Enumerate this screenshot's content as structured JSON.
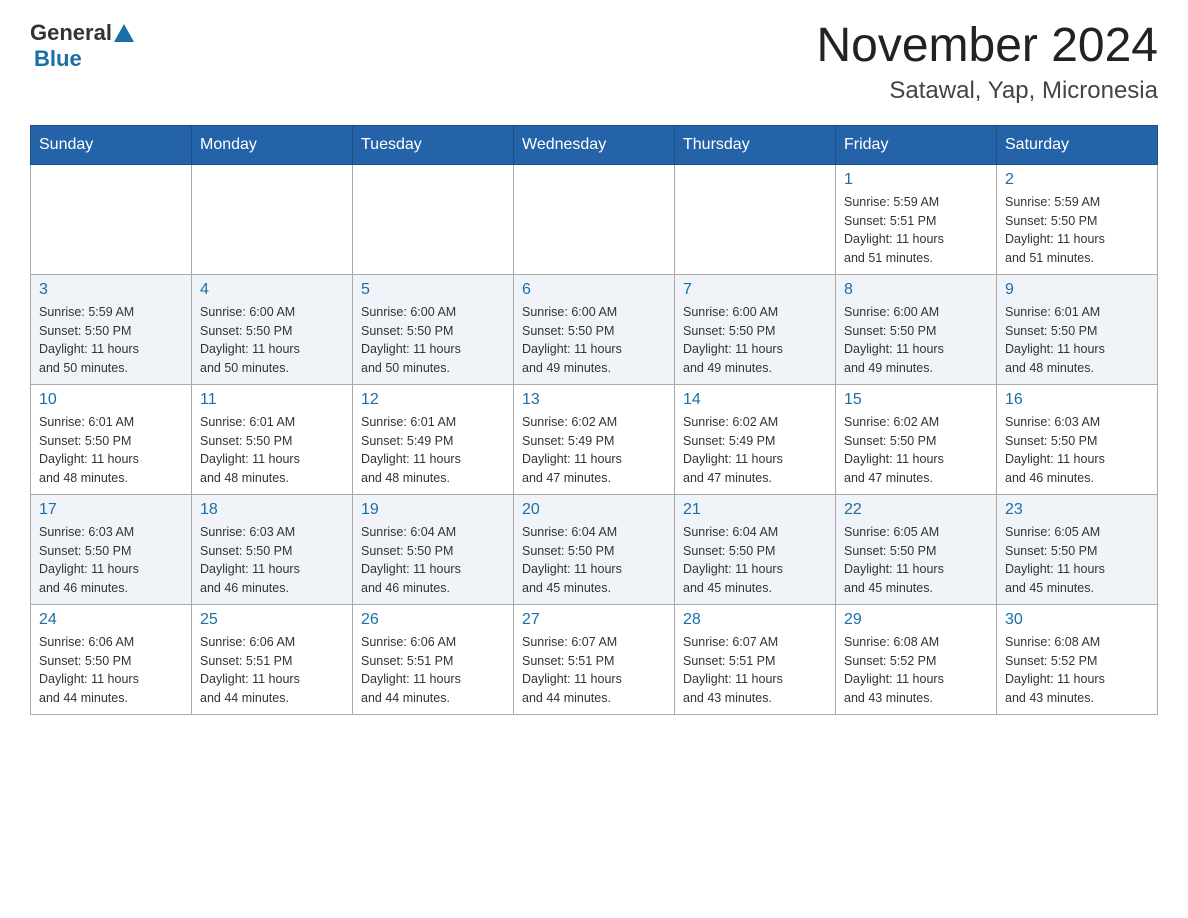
{
  "header": {
    "logo_general": "General",
    "logo_blue": "Blue",
    "month_title": "November 2024",
    "location": "Satawal, Yap, Micronesia"
  },
  "days_of_week": [
    "Sunday",
    "Monday",
    "Tuesday",
    "Wednesday",
    "Thursday",
    "Friday",
    "Saturday"
  ],
  "weeks": [
    [
      {
        "day": "",
        "info": ""
      },
      {
        "day": "",
        "info": ""
      },
      {
        "day": "",
        "info": ""
      },
      {
        "day": "",
        "info": ""
      },
      {
        "day": "",
        "info": ""
      },
      {
        "day": "1",
        "info": "Sunrise: 5:59 AM\nSunset: 5:51 PM\nDaylight: 11 hours\nand 51 minutes."
      },
      {
        "day": "2",
        "info": "Sunrise: 5:59 AM\nSunset: 5:50 PM\nDaylight: 11 hours\nand 51 minutes."
      }
    ],
    [
      {
        "day": "3",
        "info": "Sunrise: 5:59 AM\nSunset: 5:50 PM\nDaylight: 11 hours\nand 50 minutes."
      },
      {
        "day": "4",
        "info": "Sunrise: 6:00 AM\nSunset: 5:50 PM\nDaylight: 11 hours\nand 50 minutes."
      },
      {
        "day": "5",
        "info": "Sunrise: 6:00 AM\nSunset: 5:50 PM\nDaylight: 11 hours\nand 50 minutes."
      },
      {
        "day": "6",
        "info": "Sunrise: 6:00 AM\nSunset: 5:50 PM\nDaylight: 11 hours\nand 49 minutes."
      },
      {
        "day": "7",
        "info": "Sunrise: 6:00 AM\nSunset: 5:50 PM\nDaylight: 11 hours\nand 49 minutes."
      },
      {
        "day": "8",
        "info": "Sunrise: 6:00 AM\nSunset: 5:50 PM\nDaylight: 11 hours\nand 49 minutes."
      },
      {
        "day": "9",
        "info": "Sunrise: 6:01 AM\nSunset: 5:50 PM\nDaylight: 11 hours\nand 48 minutes."
      }
    ],
    [
      {
        "day": "10",
        "info": "Sunrise: 6:01 AM\nSunset: 5:50 PM\nDaylight: 11 hours\nand 48 minutes."
      },
      {
        "day": "11",
        "info": "Sunrise: 6:01 AM\nSunset: 5:50 PM\nDaylight: 11 hours\nand 48 minutes."
      },
      {
        "day": "12",
        "info": "Sunrise: 6:01 AM\nSunset: 5:49 PM\nDaylight: 11 hours\nand 48 minutes."
      },
      {
        "day": "13",
        "info": "Sunrise: 6:02 AM\nSunset: 5:49 PM\nDaylight: 11 hours\nand 47 minutes."
      },
      {
        "day": "14",
        "info": "Sunrise: 6:02 AM\nSunset: 5:49 PM\nDaylight: 11 hours\nand 47 minutes."
      },
      {
        "day": "15",
        "info": "Sunrise: 6:02 AM\nSunset: 5:50 PM\nDaylight: 11 hours\nand 47 minutes."
      },
      {
        "day": "16",
        "info": "Sunrise: 6:03 AM\nSunset: 5:50 PM\nDaylight: 11 hours\nand 46 minutes."
      }
    ],
    [
      {
        "day": "17",
        "info": "Sunrise: 6:03 AM\nSunset: 5:50 PM\nDaylight: 11 hours\nand 46 minutes."
      },
      {
        "day": "18",
        "info": "Sunrise: 6:03 AM\nSunset: 5:50 PM\nDaylight: 11 hours\nand 46 minutes."
      },
      {
        "day": "19",
        "info": "Sunrise: 6:04 AM\nSunset: 5:50 PM\nDaylight: 11 hours\nand 46 minutes."
      },
      {
        "day": "20",
        "info": "Sunrise: 6:04 AM\nSunset: 5:50 PM\nDaylight: 11 hours\nand 45 minutes."
      },
      {
        "day": "21",
        "info": "Sunrise: 6:04 AM\nSunset: 5:50 PM\nDaylight: 11 hours\nand 45 minutes."
      },
      {
        "day": "22",
        "info": "Sunrise: 6:05 AM\nSunset: 5:50 PM\nDaylight: 11 hours\nand 45 minutes."
      },
      {
        "day": "23",
        "info": "Sunrise: 6:05 AM\nSunset: 5:50 PM\nDaylight: 11 hours\nand 45 minutes."
      }
    ],
    [
      {
        "day": "24",
        "info": "Sunrise: 6:06 AM\nSunset: 5:50 PM\nDaylight: 11 hours\nand 44 minutes."
      },
      {
        "day": "25",
        "info": "Sunrise: 6:06 AM\nSunset: 5:51 PM\nDaylight: 11 hours\nand 44 minutes."
      },
      {
        "day": "26",
        "info": "Sunrise: 6:06 AM\nSunset: 5:51 PM\nDaylight: 11 hours\nand 44 minutes."
      },
      {
        "day": "27",
        "info": "Sunrise: 6:07 AM\nSunset: 5:51 PM\nDaylight: 11 hours\nand 44 minutes."
      },
      {
        "day": "28",
        "info": "Sunrise: 6:07 AM\nSunset: 5:51 PM\nDaylight: 11 hours\nand 43 minutes."
      },
      {
        "day": "29",
        "info": "Sunrise: 6:08 AM\nSunset: 5:52 PM\nDaylight: 11 hours\nand 43 minutes."
      },
      {
        "day": "30",
        "info": "Sunrise: 6:08 AM\nSunset: 5:52 PM\nDaylight: 11 hours\nand 43 minutes."
      }
    ]
  ]
}
